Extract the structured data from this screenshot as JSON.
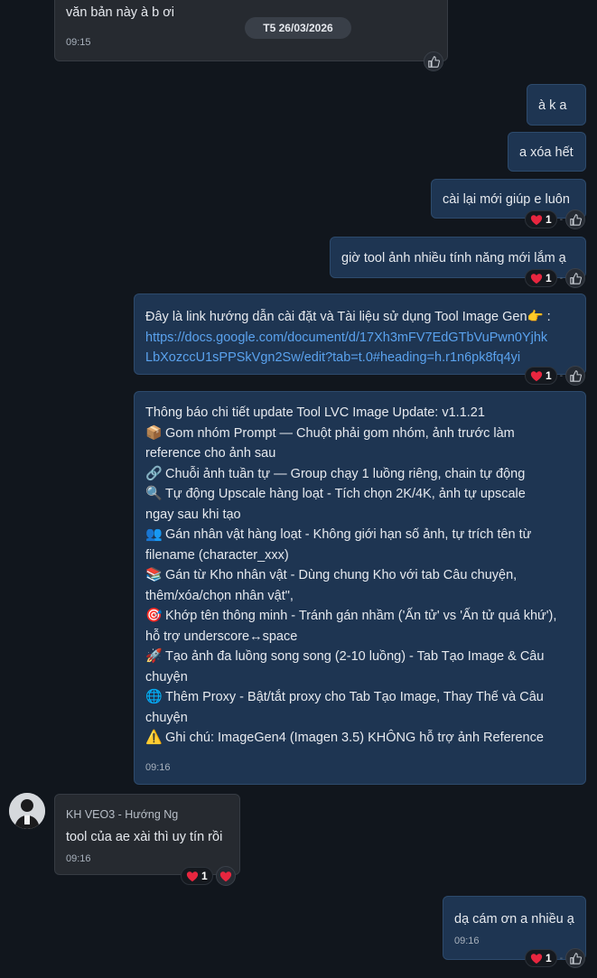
{
  "date_divider": "T5 26/03/2026",
  "messages": {
    "m1": {
      "text": "văn bản này à b ơi",
      "time": "09:15"
    },
    "m2": {
      "text": "à k a"
    },
    "m3": {
      "text": "a xóa hết"
    },
    "m4": {
      "text": "cài lại mới giúp e luôn",
      "reaction_count": "1"
    },
    "m5": {
      "text": "giờ tool ảnh nhiều tính năng mới lắm ạ",
      "reaction_count": "1"
    },
    "m6": {
      "text": "Đây là link hướng dẫn cài đặt và Tài liệu sử dụng Tool Image Gen",
      "emoji": "👉",
      "after": " :",
      "link_line1": "https://docs.google.com/document/d/17Xh3mFV7EdGTbVuPwn0Yjhk",
      "link_line2": "LbXozccU1sPPSkVgn2Sw/edit?tab=t.0#heading=h.r1n6pk8fq4yi",
      "reaction_count": "1"
    },
    "m7": {
      "title": "Thông báo chi tiết update Tool LVC Image Update: v1.1.21",
      "items": [
        {
          "icon": "📦",
          "lines": [
            "Gom nhóm Prompt — Chuột phải gom nhóm, ảnh trước làm",
            "reference cho ảnh sau"
          ]
        },
        {
          "icon": "🔗",
          "lines": [
            "Chuỗi ảnh tuần tự — Group chạy 1 luồng riêng, chain tự động"
          ]
        },
        {
          "icon": "🔍",
          "lines": [
            "Tự động Upscale hàng loạt - Tích chọn 2K/4K, ảnh tự upscale",
            "ngay sau khi tạo"
          ]
        },
        {
          "icon": "👥",
          "lines": [
            "Gán nhân vật hàng loạt - Không giới hạn số ảnh, tự trích tên từ",
            "filename (character_xxx)"
          ]
        },
        {
          "icon": "📚",
          "lines": [
            "Gán từ Kho nhân vật - Dùng chung Kho với tab Câu chuyện,",
            "thêm/xóa/chọn nhân vật\","
          ]
        },
        {
          "icon": "🎯",
          "lines": [
            "Khớp tên thông minh - Tránh gán nhầm ('Ấn tử' vs 'Ấn tử quá khứ'),",
            "hỗ trợ underscore↔space"
          ]
        },
        {
          "icon": "🚀",
          "lines": [
            "Tạo ảnh đa luồng song song (2-10 luồng) - Tab Tạo Image & Câu",
            "chuyện"
          ]
        },
        {
          "icon": "🌐",
          "lines": [
            "Thêm Proxy - Bật/tắt proxy cho Tab Tạo Image, Thay Thế và Câu",
            "chuyện"
          ]
        },
        {
          "icon": "⚠️",
          "lines": [
            "Ghi chú: ImageGen4 (Imagen 3.5) KHÔNG hỗ trợ ảnh Reference"
          ]
        }
      ],
      "time": "09:16"
    },
    "m8": {
      "sender": "KH VEO3 - Hướng Ng",
      "text": "tool của ae xài thì uy tín rồi",
      "time": "09:16",
      "reaction_count": "1"
    },
    "m9": {
      "text": "dạ cám ơn a nhiều ạ",
      "time": "09:16",
      "reaction_count": "1"
    }
  },
  "colors": {
    "background": "#11161d",
    "incoming": "#262a30",
    "outgoing": "#1e3552",
    "link": "#5aa2ee",
    "heart": "#e8263f"
  },
  "icons": {
    "react": "heart-icon",
    "like": "thumbs-up-icon"
  }
}
